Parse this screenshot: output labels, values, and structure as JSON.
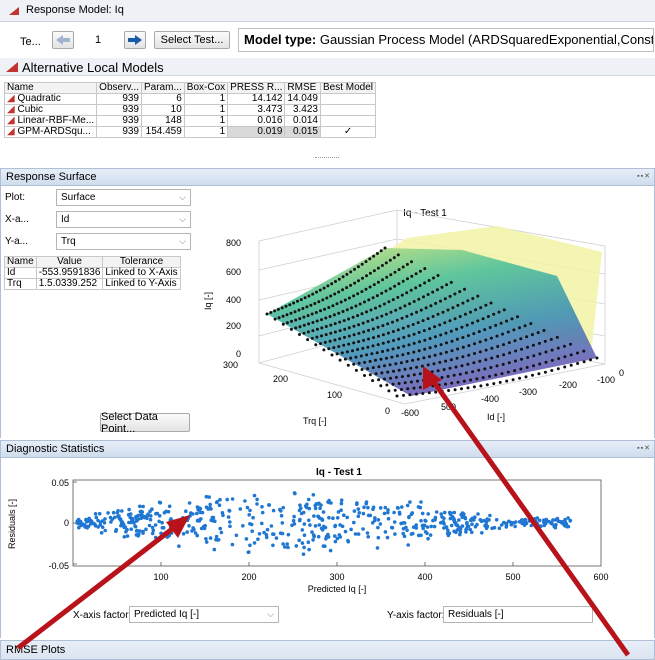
{
  "title_bar": {
    "title": "Response Model: Iq"
  },
  "toolbar": {
    "test_label": "Te...",
    "test_number": "1",
    "select_test_label": "Select Test...",
    "model_type_label": "Model type:",
    "model_type_value": "Gaussian Process Model (ARDSquaredExponential,Constant)"
  },
  "alt_models": {
    "heading": "Alternative Local Models",
    "columns": [
      "Name",
      "Observ...",
      "Param...",
      "Box-Cox",
      "PRESS R...",
      "RMSE",
      "Best Model"
    ],
    "rows": [
      {
        "name": "Quadratic",
        "obs": "939",
        "params": "6",
        "boxcox": "1",
        "press": "14.142",
        "rmse": "14.049",
        "best": ""
      },
      {
        "name": "Cubic",
        "obs": "939",
        "params": "10",
        "boxcox": "1",
        "press": "3.473",
        "rmse": "3.423",
        "best": ""
      },
      {
        "name": "Linear-RBF-Me...",
        "obs": "939",
        "params": "148",
        "boxcox": "1",
        "press": "0.016",
        "rmse": "0.014",
        "best": ""
      },
      {
        "name": "GPM-ARDSqu...",
        "obs": "939",
        "params": "154.459",
        "boxcox": "1",
        "press": "0.019",
        "rmse": "0.015",
        "best": "✓"
      }
    ]
  },
  "response_surface": {
    "heading": "Response Surface",
    "plot_label": "Plot:",
    "plot_value": "Surface",
    "xaxis_label": "X-a...",
    "xaxis_value": "Id",
    "yaxis_label": "Y-a...",
    "yaxis_value": "Trq",
    "table_columns": [
      "Name",
      "Value",
      "Tolerance"
    ],
    "table_rows": [
      {
        "name": "Id",
        "value": "-553.9591836",
        "tol": "Linked to X-Axis"
      },
      {
        "name": "Trq",
        "value": "1.5.0339.252",
        "tol": "Linked to Y-Axis"
      }
    ],
    "select_point_label": "Select Data Point...",
    "plot_title": "Iq - Test 1",
    "z_label": "Iq [-]",
    "y_label": "Trq [-]",
    "x_label": "Id [-]",
    "z_ticks": [
      "0",
      "200",
      "400",
      "600",
      "800"
    ],
    "y_ticks": [
      "300",
      "200",
      "100",
      "0"
    ],
    "x_ticks": [
      "-600",
      "500",
      "-400",
      "-300",
      "-200",
      "-100",
      "0"
    ]
  },
  "diagnostics": {
    "heading": "Diagnostic Statistics",
    "plot_title": "Iq - Test 1",
    "ylabel": "Residuals [-]",
    "xlabel": "Predicted Iq [-]",
    "y_ticks": [
      "0.05",
      "0",
      "-0.05"
    ],
    "x_ticks": [
      "100",
      "200",
      "300",
      "400",
      "500",
      "600"
    ],
    "xfactor_label": "X-axis factor:",
    "xfactor_value": "Predicted Iq [-]",
    "yfactor_label": "Y-axis factor:",
    "yfactor_value": "Residuals [-]"
  },
  "rmse": {
    "heading": "RMSE Plots"
  },
  "colors": {
    "arrow": "#b8121b",
    "dot": "#1f77d2",
    "surface_top": "#f2f2a6",
    "accent": "#0072bd"
  }
}
